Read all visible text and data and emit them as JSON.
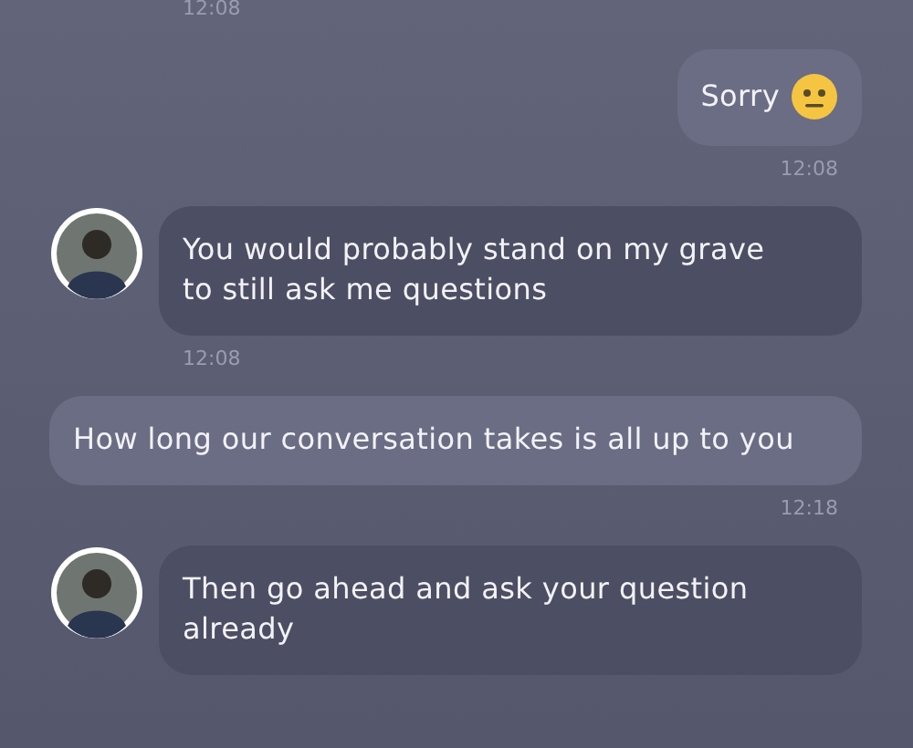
{
  "top_time": "12:08",
  "messages": [
    {
      "kind": "sent",
      "text": "Sorry",
      "emoji": true,
      "time": "12:08"
    },
    {
      "kind": "received",
      "text": "You would probably stand on my grave to still ask me questions",
      "time": "12:08"
    },
    {
      "kind": "sent",
      "text": "How long our conversation takes is all up to you",
      "wide": true,
      "time": "12:18"
    },
    {
      "kind": "received",
      "text": "Then go ahead and ask your question already"
    }
  ]
}
